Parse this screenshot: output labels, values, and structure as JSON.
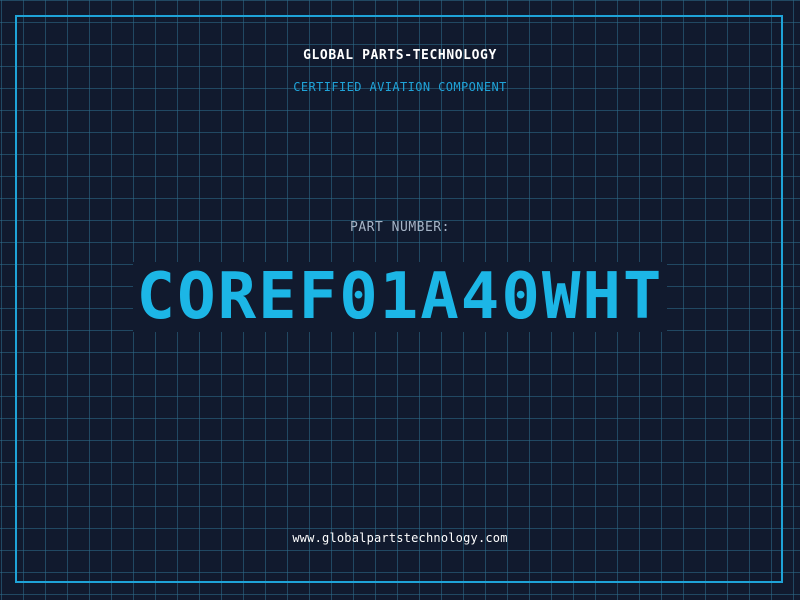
{
  "header": {
    "company": "GLOBAL PARTS-TECHNOLOGY",
    "subtitle": "CERTIFIED AVIATION COMPONENT"
  },
  "part": {
    "label": "PART NUMBER:",
    "number": "COREF01A40WHT"
  },
  "footer": {
    "url": "www.globalpartstechnology.com"
  },
  "colors": {
    "background": "#111a2e",
    "grid": "#2e6e8c",
    "accent": "#1fa3d8",
    "part_number": "#1cb6e6",
    "text": "#ffffff"
  }
}
